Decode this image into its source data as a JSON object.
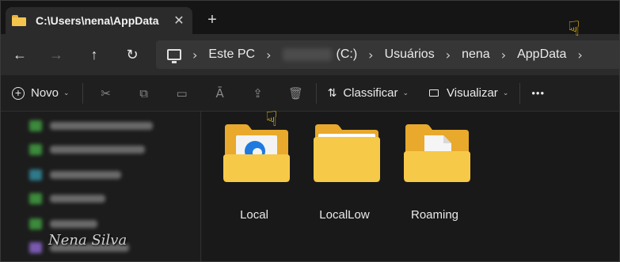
{
  "window": {
    "tab_title": "C:\\Users\\nena\\AppData",
    "tab_close": "✕",
    "new_tab": "+"
  },
  "nav": {
    "back": "←",
    "forward": "→",
    "up": "↑",
    "refresh": "↻",
    "breadcrumb": [
      "Este PC",
      "(C:)",
      "Usuários",
      "nena",
      "AppData"
    ],
    "separator": "›"
  },
  "toolbar": {
    "new_label": "Novo",
    "sort_label": "Classificar",
    "view_label": "Visualizar",
    "more": "•••"
  },
  "folders": [
    {
      "name": "Local",
      "kind": "folder-with-edge"
    },
    {
      "name": "LocalLow",
      "kind": "folder-plain"
    },
    {
      "name": "Roaming",
      "kind": "folder-with-doc"
    }
  ],
  "watermark": "Nena Silva",
  "colors": {
    "folder_back": "#e8a92c",
    "folder_front": "#f7c948",
    "edge_blue": "#1f7ae0"
  }
}
